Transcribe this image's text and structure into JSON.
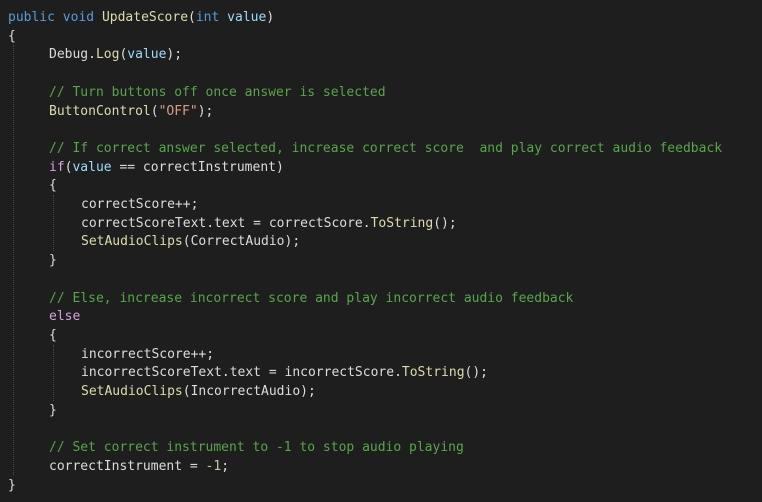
{
  "editor": {
    "theme": {
      "background": "#1e1e1e",
      "text": "#dcdcdc",
      "keyword": "#569cd6",
      "control": "#d8a0df",
      "method": "#dcdcaa",
      "parameter": "#9cdcfe",
      "string": "#d69d85",
      "comment": "#57a64a",
      "number": "#b5cea8"
    },
    "lines": [
      {
        "indent": 0,
        "tokens": [
          {
            "t": "public",
            "k": "kw"
          },
          {
            "t": " ",
            "k": "txt"
          },
          {
            "t": "void",
            "k": "kw"
          },
          {
            "t": " ",
            "k": "txt"
          },
          {
            "t": "UpdateScore",
            "k": "fn"
          },
          {
            "t": "(",
            "k": "txt"
          },
          {
            "t": "int",
            "k": "kw"
          },
          {
            "t": " ",
            "k": "txt"
          },
          {
            "t": "value",
            "k": "param"
          },
          {
            "t": ")",
            "k": "txt"
          }
        ]
      },
      {
        "indent": 0,
        "tokens": [
          {
            "t": "{",
            "k": "txt"
          }
        ]
      },
      {
        "indent": 1,
        "tokens": [
          {
            "t": "Debug.",
            "k": "txt"
          },
          {
            "t": "Log",
            "k": "fn"
          },
          {
            "t": "(",
            "k": "txt"
          },
          {
            "t": "value",
            "k": "param"
          },
          {
            "t": ");",
            "k": "txt"
          }
        ]
      },
      {
        "indent": 0,
        "tokens": []
      },
      {
        "indent": 1,
        "tokens": [
          {
            "t": "// Turn buttons off once answer is selected",
            "k": "cm"
          }
        ]
      },
      {
        "indent": 1,
        "tokens": [
          {
            "t": "ButtonControl",
            "k": "fn"
          },
          {
            "t": "(",
            "k": "txt"
          },
          {
            "t": "\"OFF\"",
            "k": "str"
          },
          {
            "t": ");",
            "k": "txt"
          }
        ]
      },
      {
        "indent": 0,
        "tokens": []
      },
      {
        "indent": 1,
        "tokens": [
          {
            "t": "// If correct answer selected, increase correct score  and play correct audio feedback",
            "k": "cm"
          }
        ]
      },
      {
        "indent": 1,
        "tokens": [
          {
            "t": "if",
            "k": "ctl"
          },
          {
            "t": "(",
            "k": "txt"
          },
          {
            "t": "value",
            "k": "param"
          },
          {
            "t": " == correctInstrument)",
            "k": "txt"
          }
        ]
      },
      {
        "indent": 1,
        "tokens": [
          {
            "t": "{",
            "k": "txt"
          }
        ]
      },
      {
        "indent": 2,
        "tokens": [
          {
            "t": "correctScore++;",
            "k": "txt"
          }
        ]
      },
      {
        "indent": 2,
        "tokens": [
          {
            "t": "correctScoreText.text = correctScore.",
            "k": "txt"
          },
          {
            "t": "ToString",
            "k": "fn"
          },
          {
            "t": "();",
            "k": "txt"
          }
        ]
      },
      {
        "indent": 2,
        "tokens": [
          {
            "t": "SetAudioClips",
            "k": "fn"
          },
          {
            "t": "(CorrectAudio);",
            "k": "txt"
          }
        ]
      },
      {
        "indent": 1,
        "tokens": [
          {
            "t": "}",
            "k": "txt"
          }
        ]
      },
      {
        "indent": 0,
        "tokens": []
      },
      {
        "indent": 1,
        "tokens": [
          {
            "t": "// Else, increase incorrect score and play incorrect audio feedback",
            "k": "cm"
          }
        ]
      },
      {
        "indent": 1,
        "tokens": [
          {
            "t": "else",
            "k": "ctl"
          }
        ]
      },
      {
        "indent": 1,
        "tokens": [
          {
            "t": "{",
            "k": "txt"
          }
        ]
      },
      {
        "indent": 2,
        "tokens": [
          {
            "t": "incorrectScore++;",
            "k": "txt"
          }
        ]
      },
      {
        "indent": 2,
        "tokens": [
          {
            "t": "incorrectScoreText.text = incorrectScore.",
            "k": "txt"
          },
          {
            "t": "ToString",
            "k": "fn"
          },
          {
            "t": "();",
            "k": "txt"
          }
        ]
      },
      {
        "indent": 2,
        "tokens": [
          {
            "t": "SetAudioClips",
            "k": "fn"
          },
          {
            "t": "(IncorrectAudio);",
            "k": "txt"
          }
        ]
      },
      {
        "indent": 1,
        "tokens": [
          {
            "t": "}",
            "k": "txt"
          }
        ]
      },
      {
        "indent": 0,
        "tokens": []
      },
      {
        "indent": 1,
        "tokens": [
          {
            "t": "// Set correct instrument to -1 to stop audio playing",
            "k": "cm"
          }
        ]
      },
      {
        "indent": 1,
        "tokens": [
          {
            "t": "correctInstrument = ",
            "k": "txt"
          },
          {
            "t": "-1",
            "k": "num"
          },
          {
            "t": ";",
            "k": "txt"
          }
        ]
      },
      {
        "indent": 0,
        "tokens": [
          {
            "t": "}",
            "k": "txt"
          }
        ]
      }
    ]
  }
}
